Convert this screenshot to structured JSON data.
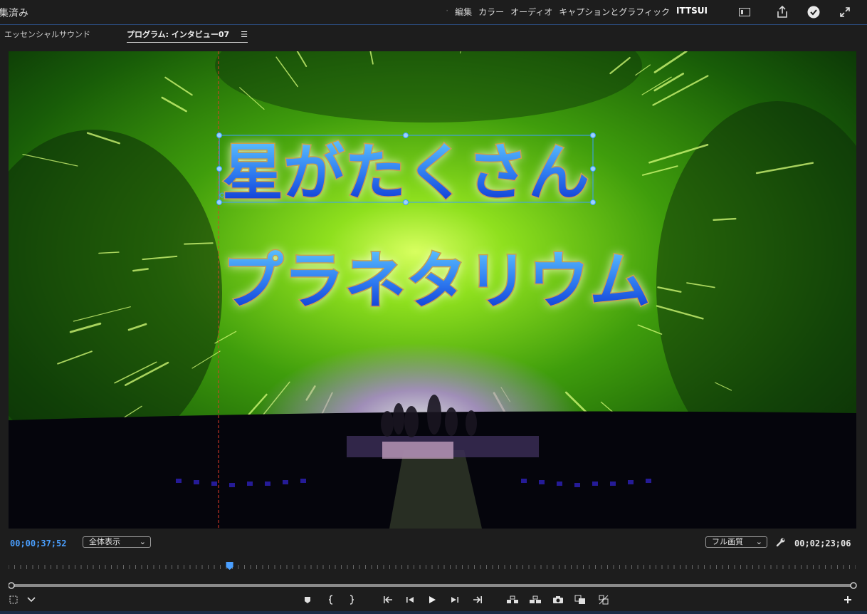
{
  "app": {
    "title": "集済み"
  },
  "workspaces": [
    "編集",
    "カラー",
    "オーディオ",
    "キャプションとグラフィック",
    "ITTSUI"
  ],
  "active_workspace": "ITTSUI",
  "panel_tabs": {
    "left": "エッセンシャルサウンド",
    "program": "プログラム: インタビュー07"
  },
  "overlay": {
    "line1": "星がたくさん",
    "line2": "プラネタリウム"
  },
  "playback": {
    "current_timecode": "00;00;37;52",
    "duration_timecode": "00;02;23;06",
    "zoom_select": "全体表示",
    "quality_select": "フル画質"
  },
  "colors": {
    "timecode_blue": "#4a9fff",
    "accent_blue": "#2f7cf0",
    "title_fill_top": "#5fc6ff",
    "title_fill_bottom": "#0a2fd0",
    "title_outline_gold": "#c9a04a",
    "selection_box": "#3aa0ff"
  },
  "icons": {
    "panel_menu": "hamburger-icon",
    "top_right": [
      "workspace-panel-icon",
      "share-icon",
      "checkmark-icon",
      "fullscreen-icon"
    ],
    "transport": [
      "add-marker-icon",
      "mark-in-icon",
      "mark-out-icon",
      "go-to-in-icon",
      "step-back-icon",
      "play-icon",
      "step-forward-icon",
      "go-to-out-icon",
      "lift-icon",
      "extract-icon",
      "export-frame-icon",
      "compare-view-icon",
      "toggle-proxy-icon",
      "add-button-icon"
    ]
  },
  "playhead_fraction": 0.261
}
